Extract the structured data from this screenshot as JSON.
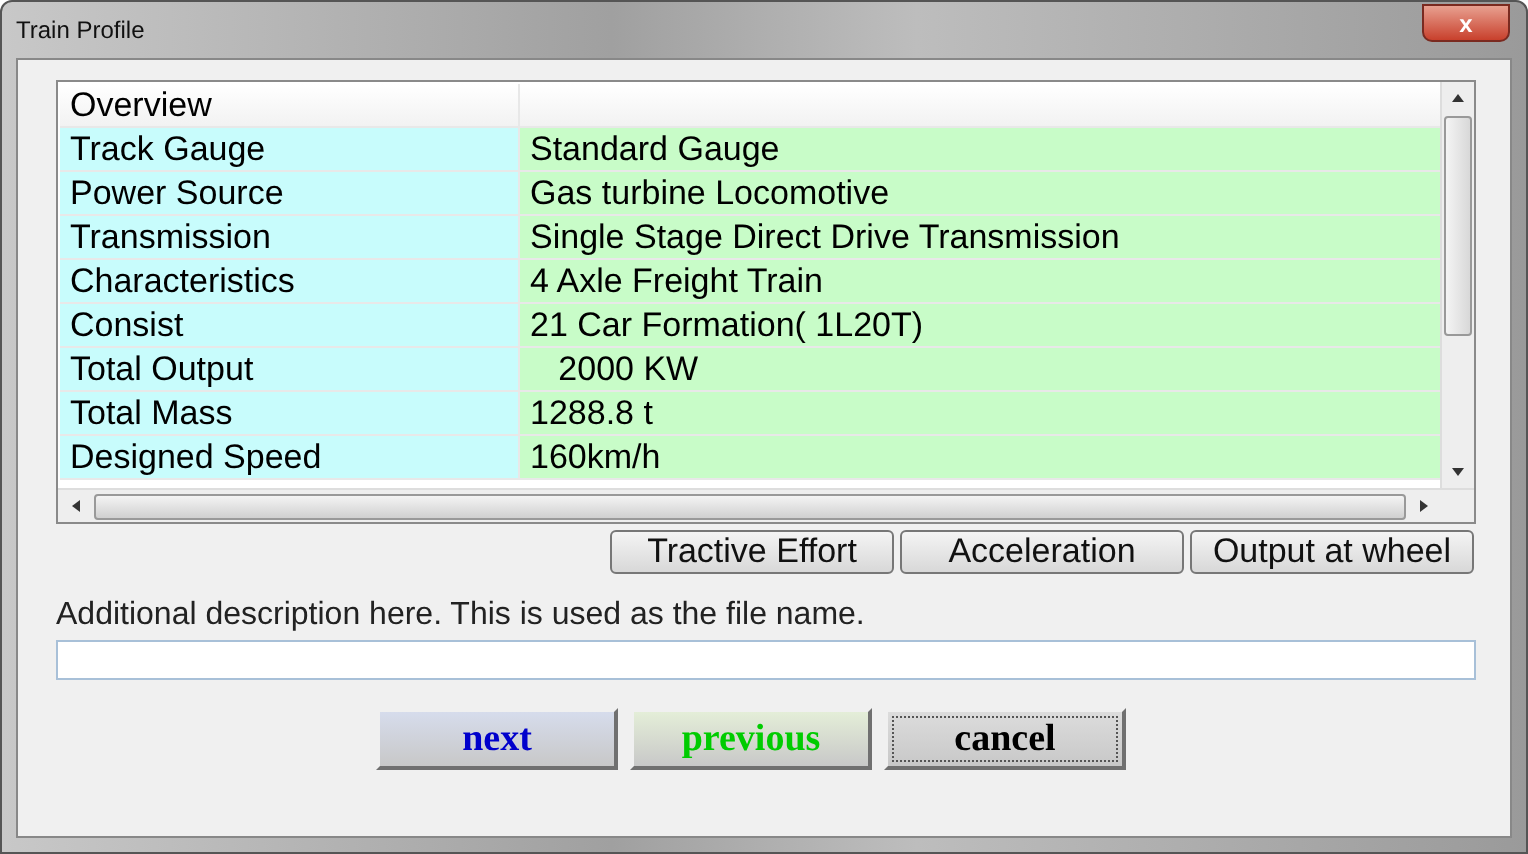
{
  "window": {
    "title": "Train Profile",
    "close_label": "x"
  },
  "grid": {
    "header": "Overview",
    "rows": [
      {
        "label": "Track Gauge",
        "value": "Standard Gauge"
      },
      {
        "label": "Power Source",
        "value": "Gas turbine Locomotive"
      },
      {
        "label": "Transmission",
        "value": "Single Stage Direct Drive Transmission"
      },
      {
        "label": "Characteristics",
        "value": "4 Axle Freight Train"
      },
      {
        "label": "Consist",
        "value": "21 Car Formation( 1L20T)"
      },
      {
        "label": "Total Output",
        "value": "   2000 KW"
      },
      {
        "label": "Total Mass",
        "value": "1288.8 t"
      },
      {
        "label": "Designed Speed",
        "value": "160km/h"
      }
    ]
  },
  "chart_buttons": [
    "Tractive Effort",
    "Acceleration",
    "Output at wheel"
  ],
  "description": {
    "label": "Additional description here. This is used as the file name."
  },
  "buttons": [
    {
      "label": "next",
      "color": "#0000cc",
      "focused": false
    },
    {
      "label": "previous",
      "color": "#00cc00",
      "focused": false
    },
    {
      "label": "cancel",
      "color": "#000000",
      "focused": true
    }
  ]
}
